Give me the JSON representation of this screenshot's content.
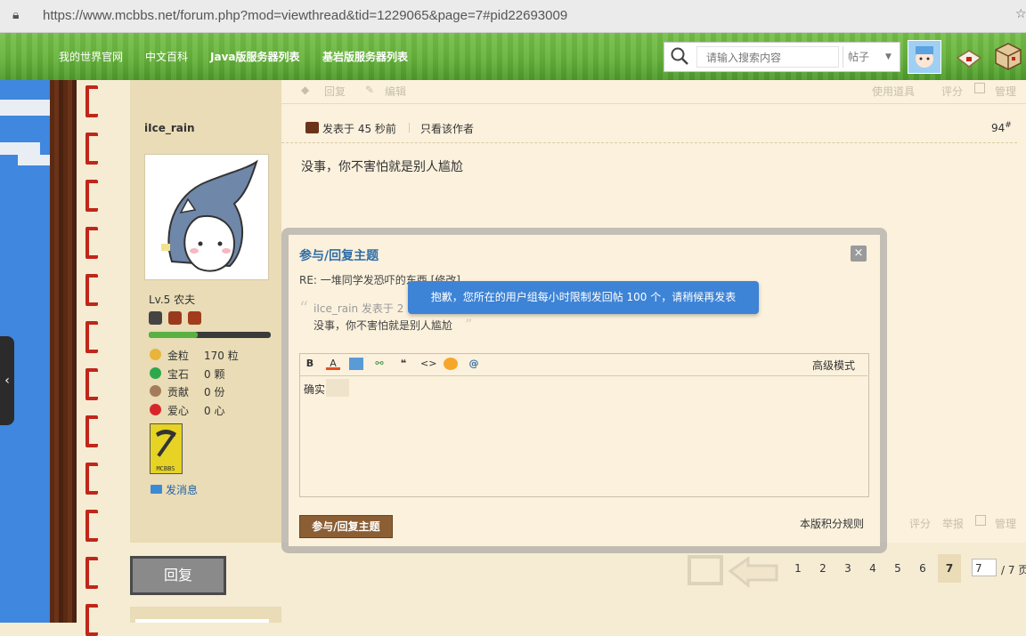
{
  "browser": {
    "url": "https://www.mcbbs.net/forum.php?mod=viewthread&tid=1229065&page=7#pid22693009"
  },
  "nav": {
    "links": [
      "我的世界官网",
      "中文百科",
      "Java版服务器列表",
      "基岩版服务器列表"
    ],
    "search_placeholder": "请输入搜索内容",
    "search_type": "帖子"
  },
  "post_toolbar": {
    "reply": "回复",
    "edit": "编辑",
    "tools": "使用道具",
    "rate": "评分",
    "manage": "管理"
  },
  "author": {
    "name": "iIce_rain",
    "level": "Lv.5 农夫",
    "stats": [
      {
        "label": "金粒",
        "value": "170 粒"
      },
      {
        "label": "宝石",
        "value": "0 颗"
      },
      {
        "label": "贡献",
        "value": "0 份"
      },
      {
        "label": "爱心",
        "value": "0 心"
      }
    ],
    "badge_text": "MCBBS",
    "message": "发消息"
  },
  "post": {
    "time": "发表于 45 秒前",
    "only_author": "只看该作者",
    "floor": "94",
    "floor_sup": "#",
    "body": "没事，你不害怕就是别人尴尬"
  },
  "modal": {
    "title": "参与/回复主题",
    "close": "×",
    "subject": "RE: 一堆同学发恐吓的东西 [修改]",
    "quote_author": "iIce_rain 发表于 2",
    "quote_text": "没事，你不害怕就是别人尴尬",
    "tooltip": "抱歉，您所在的用户组每小时限制发回帖 100 个，请稍候再发表",
    "advanced_mode": "高级模式",
    "editor_text": "确实",
    "submit": "参与/回复主题",
    "rules": "本版积分规则"
  },
  "footer_ghost": {
    "rate": "评分",
    "report": "举报",
    "manage": "管理"
  },
  "reply_button": "回复",
  "pagination": {
    "pages": [
      "1",
      "2",
      "3",
      "4",
      "5",
      "6"
    ],
    "current": "7",
    "input": "7",
    "total": "/ 7 页"
  }
}
